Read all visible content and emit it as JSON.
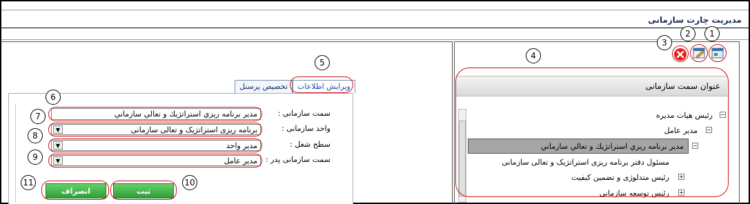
{
  "header": {
    "title": "مدیریت چارت سازمانی"
  },
  "tabs": [
    {
      "label": "ویرایش اطلاعات"
    },
    {
      "label": "تخصیص پرسنل"
    }
  ],
  "form": {
    "position_label": "سمت سازمانی :",
    "position_value": "مدير برنامه ريزي استراتژيك و تعالي سازماني",
    "unit_label": "واحد سازمانی :",
    "unit_value": "برنامه ریزی استراتژیک و تعالی سازمانی",
    "job_level_label": "سطح شغل :",
    "job_level_value": "مدیر واحد",
    "parent_position_label": "سمت سازمانی پدر :",
    "parent_position_value": "مدیر عامل"
  },
  "buttons": {
    "save": "ثبت",
    "cancel": "انصراف"
  },
  "right_panel": {
    "header": "عنوان سمت سازمانی",
    "tree": [
      {
        "label": "رئیس هیات مدیره",
        "toggle": "−"
      },
      {
        "label": "مدیر عامل",
        "toggle": "−"
      },
      {
        "label": "مدير برنامه ريزي استراتژيك و تعالي سازماني",
        "toggle": "−"
      },
      {
        "label": "مسئول دفتر برنامه ریزی استراتژیک و تعالی سازمانی",
        "toggle": ""
      },
      {
        "label": "رئیس متدلوژی و تضمین کیفیت",
        "toggle": "+"
      },
      {
        "label": "رئیس توسعه سازمانی",
        "toggle": "+"
      }
    ]
  },
  "callouts": [
    "1",
    "2",
    "3",
    "4",
    "5",
    "6",
    "7",
    "8",
    "9",
    "10",
    "11"
  ],
  "colors": {
    "accent": "#c00000",
    "button_green": "#3fb344",
    "title_blue": "#1a2a5a"
  }
}
